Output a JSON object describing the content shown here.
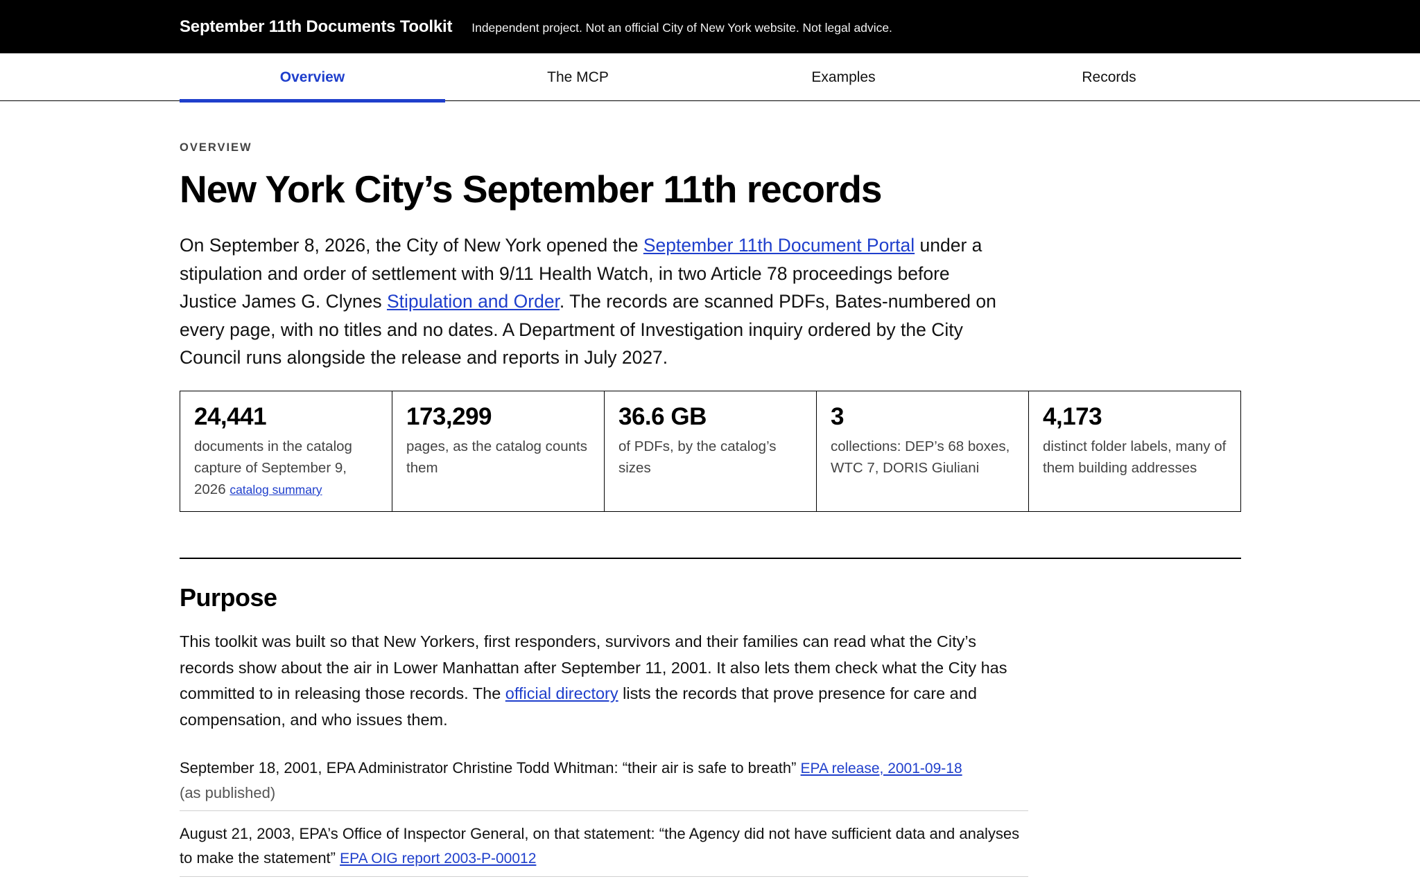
{
  "header": {
    "brand": "September 11th Documents Toolkit",
    "tagline": "Independent project. Not an official City of New York website. Not legal advice."
  },
  "nav": {
    "tabs": [
      {
        "label": "Overview",
        "active": true
      },
      {
        "label": "The MCP",
        "active": false
      },
      {
        "label": "Examples",
        "active": false
      },
      {
        "label": "Records",
        "active": false
      }
    ]
  },
  "overview": {
    "eyebrow": "OVERVIEW",
    "title": "New York City’s September 11th records",
    "intro": {
      "part1": "On September 8, 2026, the City of New York opened the ",
      "link1": "September 11th Document Portal",
      "part2": " under a stipulation and order of settlement with 9/11 Health Watch, in two Article 78 proceedings before Justice James G. Clynes ",
      "link2": "Stipulation and Order",
      "part3": ". The records are scanned PDFs, Bates-numbered on every page, with no titles and no dates. A Department of Investigation inquiry ordered by the City Council runs alongside the release and reports in July 2027."
    },
    "stats": [
      {
        "value": "24,441",
        "desc": "documents in the catalog capture of September 9, 2026 ",
        "link": "catalog summary"
      },
      {
        "value": "173,299",
        "desc": "pages, as the catalog counts them",
        "link": ""
      },
      {
        "value": "36.6 GB",
        "desc": "of PDFs, by the catalog’s sizes",
        "link": ""
      },
      {
        "value": "3",
        "desc": "collections: DEP’s 68 boxes, WTC 7, DORIS Giuliani",
        "link": ""
      },
      {
        "value": "4,173",
        "desc": "distinct folder labels, many of them building addresses",
        "link": ""
      }
    ]
  },
  "purpose": {
    "heading": "Purpose",
    "text": {
      "part1": "This toolkit was built so that New Yorkers, first responders, survivors and their families can read what the City’s records show about the air in Lower Manhattan after September 11, 2001. It also lets them check what the City has committed to in releasing those records. The ",
      "link": "official directory",
      "part2": " lists the records that prove presence for care and compensation, and who issues them."
    },
    "quotes": [
      {
        "text": "September 18, 2001, EPA Administrator Christine Todd Whitman: “their air is safe to breath” ",
        "link": "EPA release, 2001-09-18",
        "note": "(as published)"
      },
      {
        "text": "August 21, 2003, EPA’s Office of Inspector General, on that statement: “the Agency did not have sufficient data and analyses to make the statement” ",
        "link": "EPA OIG report 2003-P-00012",
        "note": ""
      }
    ]
  }
}
